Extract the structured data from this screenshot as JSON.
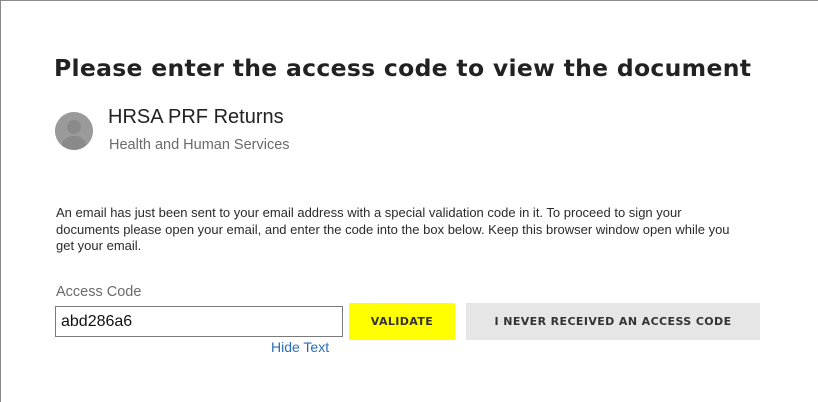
{
  "page": {
    "heading": "Please enter the access code to view the document"
  },
  "sender": {
    "avatar_icon": "user-avatar-icon",
    "name": "HRSA PRF Returns",
    "organization": "Health and Human Services"
  },
  "message": {
    "text": "An email has just been sent to your email address with a special validation code in it. To proceed to sign your documents please open your email, and enter the code into the box below. Keep this browser window open while you get your email."
  },
  "access_code": {
    "label": "Access Code",
    "value": "abd286a6",
    "hide_text_link": "Hide Text"
  },
  "buttons": {
    "validate_label": "VALIDATE",
    "never_received_label": "I NEVER RECEIVED AN ACCESS CODE"
  },
  "colors": {
    "validate_bg": "#ffff00",
    "secondary_bg": "#e6e6e6",
    "link": "#2a6eb8"
  }
}
